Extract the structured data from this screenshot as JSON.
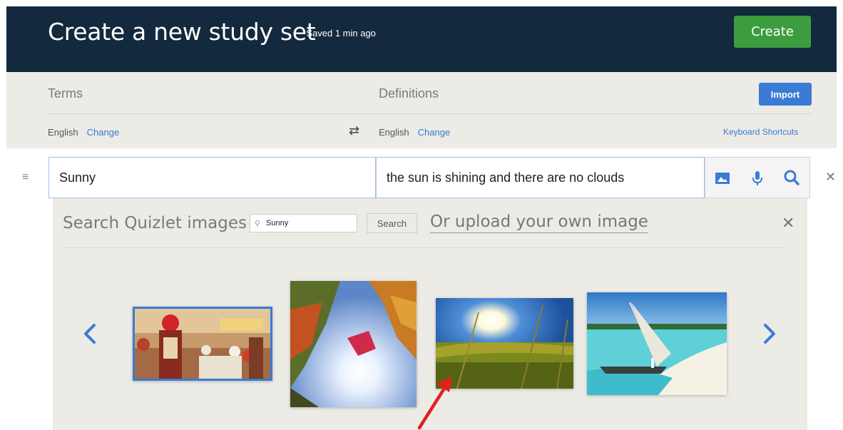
{
  "header": {
    "title": "Create a new study set",
    "saved_status": "Saved 1 min ago",
    "create_label": "Create"
  },
  "columns": {
    "terms_heading": "Terms",
    "definitions_heading": "Definitions",
    "import_label": "Import",
    "term_language": "English",
    "definition_language": "English",
    "change_label": "Change",
    "keyboard_shortcuts": "Keyboard Shortcuts"
  },
  "card": {
    "term": "Sunny",
    "definition": "the sun is shining and there are no clouds"
  },
  "image_search": {
    "label": "Search Quizlet images",
    "query": "Sunny",
    "search_label": "Search",
    "upload_label": "Or upload your own image"
  },
  "icons": {
    "drag_handle": "drag-handle-icon",
    "swap": "swap-icon",
    "image": "image-icon",
    "mic": "mic-icon",
    "search": "search-icon",
    "close": "close-icon",
    "prev": "chevron-left-icon",
    "next": "chevron-right-icon"
  },
  "colors": {
    "header_bg": "#13293d",
    "create_green": "#3c9d3f",
    "accent_blue": "#3a7bd5",
    "panel_bg": "#ecebe6",
    "annotation_red": "#e32020"
  }
}
